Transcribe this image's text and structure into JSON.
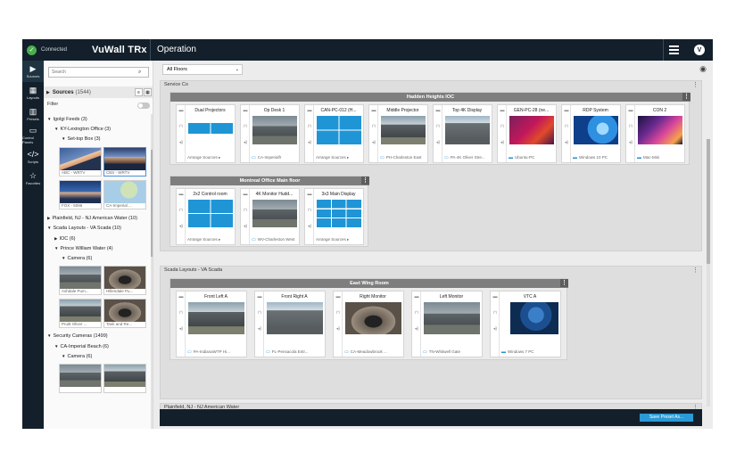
{
  "topbar": {
    "status": "Connected",
    "brand": "VuWall TRx",
    "page": "Operation",
    "user_initial": "V"
  },
  "rail": [
    {
      "label": "Sources",
      "icon": "sources-icon",
      "glyph": "▶"
    },
    {
      "label": "Layouts",
      "icon": "layouts-icon",
      "glyph": "▦"
    },
    {
      "label": "Presets",
      "icon": "presets-icon",
      "glyph": "▥"
    },
    {
      "label": "Control Panels",
      "icon": "control-panels-icon",
      "glyph": "▭"
    },
    {
      "label": "Scripts",
      "icon": "scripts-icon",
      "glyph": "</>"
    },
    {
      "label": "Favorites",
      "icon": "favorites-icon",
      "glyph": "☆"
    }
  ],
  "sources": {
    "search_placeholder": "Search",
    "title": "Sources",
    "count": "(1544)",
    "filter_label": "Filter",
    "tree": [
      {
        "text": "Igolgi Feeds (3)",
        "level": 0,
        "open": true
      },
      {
        "text": "KY-Lexington Office (3)",
        "level": 1,
        "open": true
      },
      {
        "text": "Set-top Box (3)",
        "level": 2,
        "open": true
      },
      {
        "text": "Plainfield, NJ - NJ American Water (10)",
        "level": 0,
        "open": false
      },
      {
        "text": "Scada Layouts - VA Scada (10)",
        "level": 0,
        "open": true
      },
      {
        "text": "IOC (6)",
        "level": 1,
        "open": false
      },
      {
        "text": "Prince William Water (4)",
        "level": 1,
        "open": true
      },
      {
        "text": "Camera (6)",
        "level": 2,
        "open": true
      },
      {
        "text": "Security Cameras (1499)",
        "level": 0,
        "open": true
      },
      {
        "text": "CA-Imperial Beach (6)",
        "level": 1,
        "open": true
      },
      {
        "text": "Camera (6)",
        "level": 2,
        "open": true
      }
    ],
    "thumbs": [
      {
        "caption": "ABC - WRTV",
        "kind": "news",
        "selected": false
      },
      {
        "caption": "CBS - WRTV",
        "kind": "news2",
        "selected": true
      },
      {
        "caption": "FOX - 5096",
        "kind": "news3",
        "selected": false
      },
      {
        "caption": "CA-Imperial ...",
        "kind": "map",
        "selected": false
      },
      {
        "caption": "Ashdale Pum...",
        "kind": "road",
        "selected": false
      },
      {
        "caption": "Hillendale Pu...",
        "kind": "tunnel",
        "selected": false
      },
      {
        "caption": "Pruitt Oliver ...",
        "kind": "road2",
        "selected": false
      },
      {
        "caption": "Tank and Re...",
        "kind": "tunnel",
        "selected": false
      },
      {
        "caption": "",
        "kind": "road",
        "selected": false
      },
      {
        "caption": "",
        "kind": "road2",
        "selected": false
      }
    ]
  },
  "main": {
    "floor": "All Floors",
    "groups": [
      {
        "title": "Service Co",
        "walls": [
          {
            "title": "Hadden Heights IOC",
            "tiles": [
              {
                "name": "Dual Projectors",
                "view": "dual",
                "footer": "Arrange Sources ▸",
                "footer_icon": ""
              },
              {
                "name": "Op Desk 1",
                "view": "road",
                "footer": "CA-Imperialfr",
                "footer_icon": "monitor"
              },
              {
                "name": "CAN-PC-012 (H...",
                "view": "quad",
                "footer": "Arrange Sources ▸",
                "footer_icon": ""
              },
              {
                "name": "Middle Projector",
                "view": "road2",
                "footer": "PH-Charleston East",
                "footer_icon": "monitor"
              },
              {
                "name": "Top 4K Display",
                "view": "road3",
                "footer": "PA-4K Oliver Stre...",
                "footer_icon": "monitor"
              },
              {
                "name": "GEN-PC-28 (ne...",
                "view": "ubuntu",
                "footer": "Ubuntu-PC",
                "footer_icon": "pc"
              },
              {
                "name": "RDP System",
                "view": "win10",
                "footer": "Windows 10 PC",
                "footer_icon": "pc"
              },
              {
                "name": "CON 2",
                "view": "mac",
                "footer": "Mac-Mini",
                "footer_icon": "pc"
              }
            ]
          },
          {
            "title": "Montreal Office Main floor",
            "tiles": [
              {
                "name": "2x2 Control room",
                "view": "quad",
                "footer": "Arrange Sources ▸",
                "footer_icon": ""
              },
              {
                "name": "4K Monitor Hudd...",
                "view": "road",
                "footer": "WV-Charleston West",
                "footer_icon": "monitor"
              },
              {
                "name": "3x3 Main Display",
                "view": "nine",
                "footer": "Arrange Sources ▸",
                "footer_icon": ""
              }
            ]
          }
        ]
      },
      {
        "title": "Scada Layouts - VA Scada",
        "walls": [
          {
            "title": "East Wing Room",
            "tiles": [
              {
                "name": "Front Left A",
                "view": "road2",
                "footer": "PA-IndianaWTP Hi...",
                "footer_icon": "monitor"
              },
              {
                "name": "Front Right A",
                "view": "road3",
                "footer": "FL-Pensacola Entr...",
                "footer_icon": "monitor"
              },
              {
                "name": "Right Monitor",
                "view": "tunnel",
                "footer": "CA-Meadowbrook ...",
                "footer_icon": "monitor"
              },
              {
                "name": "Left Monitor",
                "view": "road",
                "footer": "TN-Whitwell Gate",
                "footer_icon": "monitor"
              },
              {
                "name": "VTC A",
                "view": "vtc",
                "footer": "Windows 7 PC",
                "footer_icon": "pc"
              }
            ]
          }
        ]
      },
      {
        "title": "Plainfield, NJ - NJ American Water",
        "walls": []
      }
    ],
    "save_button": "Save Preset As..."
  },
  "icons": {
    "monitor": "▭",
    "pc": "▬",
    "lock": "🔒",
    "audio": "◂)",
    "source": "▬",
    "kebab": "⋮",
    "eye": "◉",
    "search": "⌕",
    "check": "✓"
  },
  "colors": {
    "topbar": "#13202b",
    "accent": "#2b9ad6",
    "connected": "#47b04b",
    "wall_header": "#7e7e7e"
  }
}
